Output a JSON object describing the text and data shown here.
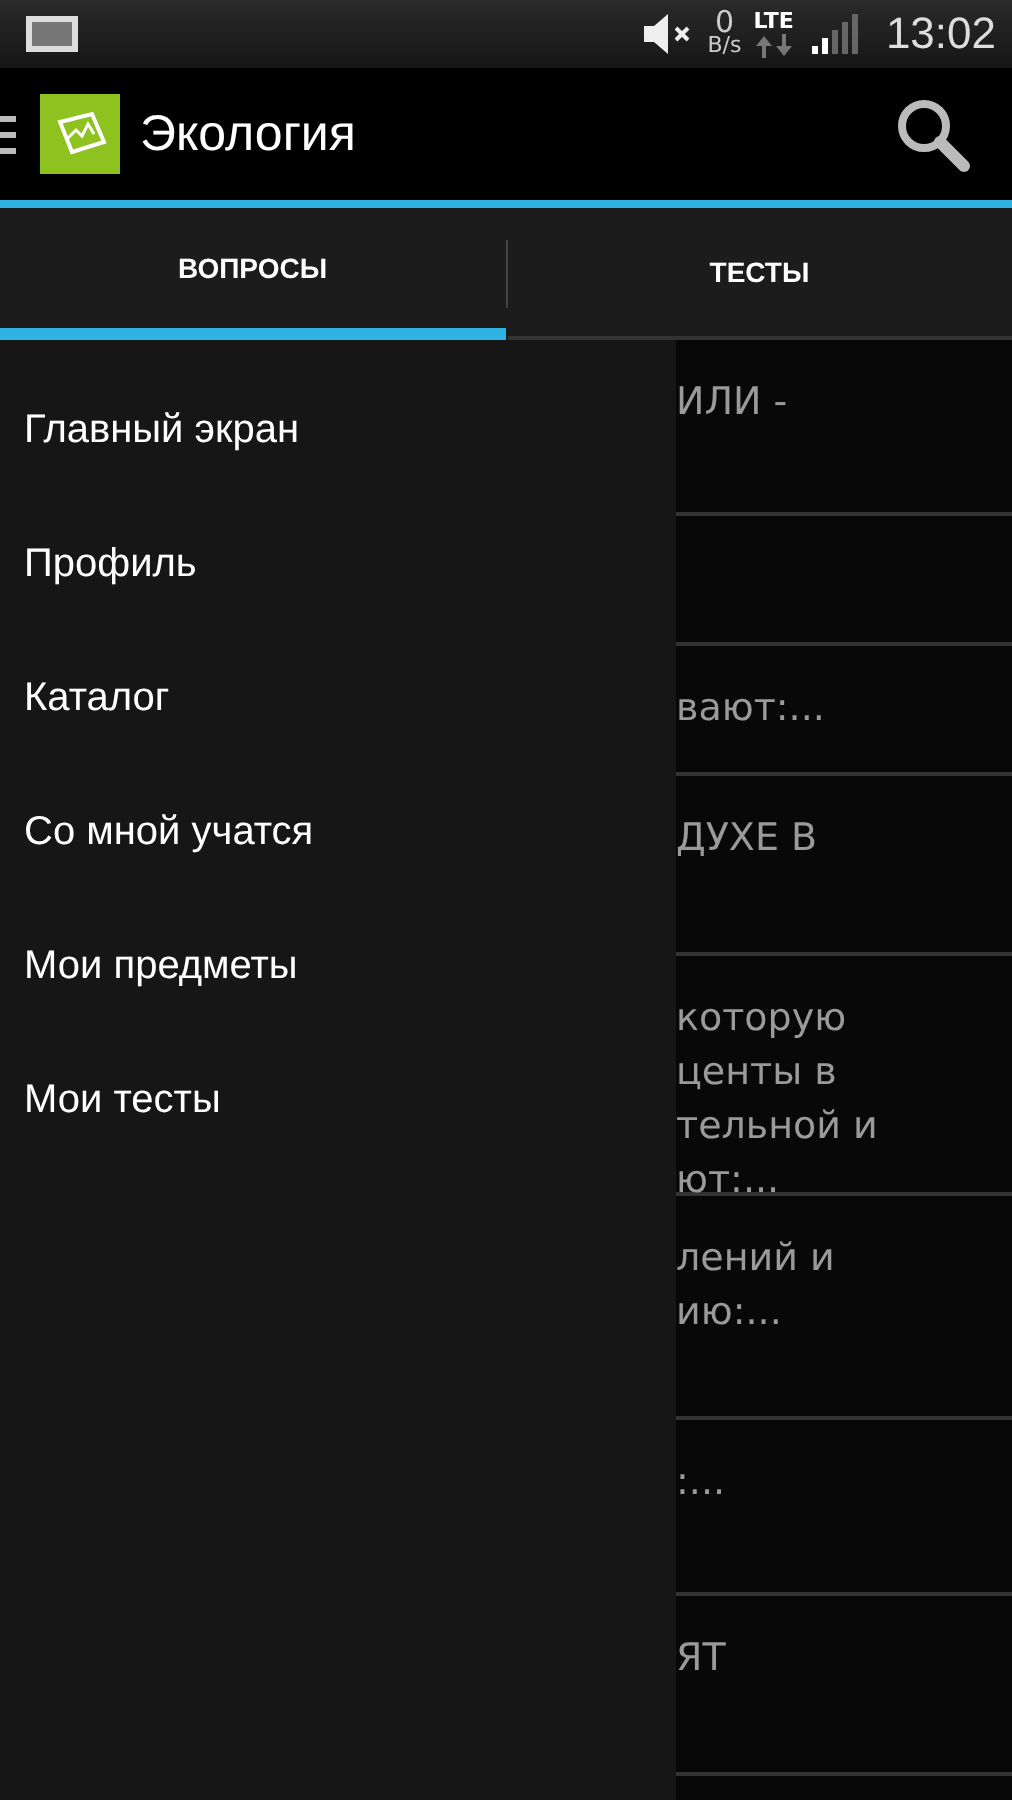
{
  "status_bar": {
    "net_speed": "0",
    "net_unit": "B/s",
    "network": "LTE",
    "time": "13:02"
  },
  "app_bar": {
    "title": "Экология"
  },
  "tabs": [
    {
      "label": "ВОПРОСЫ",
      "selected": true
    },
    {
      "label": "ТЕСТЫ",
      "selected": false
    }
  ],
  "drawer": {
    "items": [
      "Главный экран",
      "Профиль",
      "Каталог",
      "Со мной учатся",
      "Мои предметы",
      "Мои тесты"
    ]
  },
  "list_rows": [
    {
      "lines": [
        "ИЛИ -"
      ]
    },
    {
      "lines": []
    },
    {
      "lines": [
        "вают:..."
      ]
    },
    {
      "lines": [
        "ДУХЕ В"
      ]
    },
    {
      "lines": [
        "которую",
        "центы в",
        "тельной и",
        "ют:..."
      ]
    },
    {
      "lines": [
        "лений и",
        "ию:..."
      ]
    },
    {
      "lines": [
        ":..."
      ]
    },
    {
      "lines": [
        "ЯТ"
      ]
    }
  ]
}
